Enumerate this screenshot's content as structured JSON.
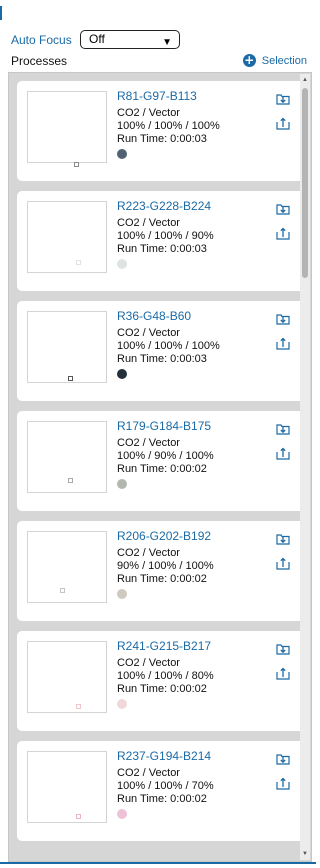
{
  "auto_focus": {
    "label": "Auto Focus",
    "selected": "Off"
  },
  "processes": {
    "title": "Processes",
    "selection_label": "Selection"
  },
  "cards": [
    {
      "title": "R81-G97-B113",
      "type": "CO2 / Vector",
      "settings": "100% / 100% / 100%",
      "run_time": "Run Time: 0:00:03",
      "color": "#516171",
      "mark_border": "#8b8b8b"
    },
    {
      "title": "R223-G228-B224",
      "type": "CO2 / Vector",
      "settings": "100% / 100% / 90%",
      "run_time": "Run Time: 0:00:03",
      "color": "#dfe4e0",
      "mark_border": "#e3e3e3"
    },
    {
      "title": "R36-G48-B60",
      "type": "CO2 / Vector",
      "settings": "100% / 100% / 100%",
      "run_time": "Run Time: 0:00:03",
      "color": "#24303c",
      "mark_border": "#555555"
    },
    {
      "title": "R179-G184-B175",
      "type": "CO2 / Vector",
      "settings": "100% / 90% / 100%",
      "run_time": "Run Time: 0:00:02",
      "color": "#b3b8af",
      "mark_border": "#a8a8a8"
    },
    {
      "title": "R206-G202-B192",
      "type": "CO2 / Vector",
      "settings": "90% / 100% / 100%",
      "run_time": "Run Time: 0:00:02",
      "color": "#cecac0",
      "mark_border": "#c4c4c4"
    },
    {
      "title": "R241-G215-B217",
      "type": "CO2 / Vector",
      "settings": "100% / 100% / 80%",
      "run_time": "Run Time: 0:00:02",
      "color": "#f1d7d9",
      "mark_border": "#f0c8cc"
    },
    {
      "title": "R237-G194-B214",
      "type": "CO2 / Vector",
      "settings": "100% / 100% / 70%",
      "run_time": "Run Time: 0:00:02",
      "color": "#edc2d6",
      "mark_border": "#ebb5ca"
    }
  ],
  "accent_color": "#1b6aa5"
}
